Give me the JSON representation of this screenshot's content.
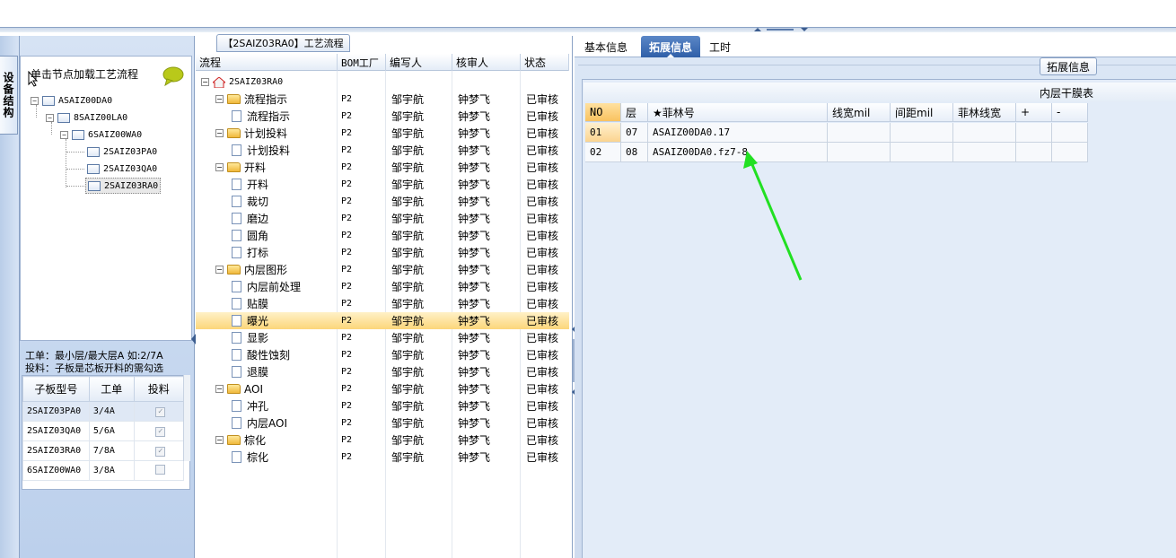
{
  "left": {
    "vertical_tab": "设备结构",
    "load_hint": "单击节点加载工艺流程",
    "tree": [
      {
        "label": "ASAIZ00DA0",
        "level": 0
      },
      {
        "label": "8SAIZ00LA0",
        "level": 1
      },
      {
        "label": "6SAIZ00WA0",
        "level": 2
      },
      {
        "label": "2SAIZ03PA0",
        "level": 3
      },
      {
        "label": "2SAIZ03QA0",
        "level": 3
      },
      {
        "label": "2SAIZ03RA0",
        "level": 3,
        "selected": true
      }
    ],
    "info_line1": "工单：最小层/最大层A 如:2/7A",
    "info_line2": "投料：子板是芯板开料的需勾选",
    "sub_table": {
      "headers": [
        "子板型号",
        "工单",
        "投料"
      ],
      "rows": [
        {
          "model": "2SAIZ03PA0",
          "order": "3/4A",
          "checked": true
        },
        {
          "model": "2SAIZ03QA0",
          "order": "5/6A",
          "checked": true
        },
        {
          "model": "2SAIZ03RA0",
          "order": "7/8A",
          "checked": true
        },
        {
          "model": "6SAIZ00WA0",
          "order": "3/8A",
          "checked": false
        }
      ]
    }
  },
  "middle": {
    "title": "【2SAIZ03RA0】工艺流程",
    "headers": [
      "流程",
      "BOM工厂",
      "编写人",
      "核审人",
      "状态"
    ],
    "root": "2SAIZ03RA0",
    "rows": [
      {
        "name": "流程指示",
        "type": "folder",
        "factory": "P2",
        "writer": "邹宇航",
        "reviewer": "钟梦飞",
        "status": "已审核"
      },
      {
        "name": "流程指示",
        "type": "leaf",
        "factory": "P2",
        "writer": "邹宇航",
        "reviewer": "钟梦飞",
        "status": "已审核"
      },
      {
        "name": "计划投料",
        "type": "folder",
        "factory": "P2",
        "writer": "邹宇航",
        "reviewer": "钟梦飞",
        "status": "已审核"
      },
      {
        "name": "计划投料",
        "type": "leaf",
        "factory": "P2",
        "writer": "邹宇航",
        "reviewer": "钟梦飞",
        "status": "已审核"
      },
      {
        "name": "开料",
        "type": "folder",
        "factory": "P2",
        "writer": "邹宇航",
        "reviewer": "钟梦飞",
        "status": "已审核"
      },
      {
        "name": "开料",
        "type": "leaf",
        "factory": "P2",
        "writer": "邹宇航",
        "reviewer": "钟梦飞",
        "status": "已审核"
      },
      {
        "name": "裁切",
        "type": "leaf",
        "factory": "P2",
        "writer": "邹宇航",
        "reviewer": "钟梦飞",
        "status": "已审核"
      },
      {
        "name": "磨边",
        "type": "leaf",
        "factory": "P2",
        "writer": "邹宇航",
        "reviewer": "钟梦飞",
        "status": "已审核"
      },
      {
        "name": "圆角",
        "type": "leaf",
        "factory": "P2",
        "writer": "邹宇航",
        "reviewer": "钟梦飞",
        "status": "已审核"
      },
      {
        "name": "打标",
        "type": "leaf",
        "factory": "P2",
        "writer": "邹宇航",
        "reviewer": "钟梦飞",
        "status": "已审核"
      },
      {
        "name": "内层图形",
        "type": "folder",
        "factory": "P2",
        "writer": "邹宇航",
        "reviewer": "钟梦飞",
        "status": "已审核"
      },
      {
        "name": "内层前处理",
        "type": "leaf",
        "factory": "P2",
        "writer": "邹宇航",
        "reviewer": "钟梦飞",
        "status": "已审核"
      },
      {
        "name": "贴膜",
        "type": "leaf",
        "factory": "P2",
        "writer": "邹宇航",
        "reviewer": "钟梦飞",
        "status": "已审核"
      },
      {
        "name": "曝光",
        "type": "leaf",
        "factory": "P2",
        "writer": "邹宇航",
        "reviewer": "钟梦飞",
        "status": "已审核",
        "selected": true
      },
      {
        "name": "显影",
        "type": "leaf",
        "factory": "P2",
        "writer": "邹宇航",
        "reviewer": "钟梦飞",
        "status": "已审核"
      },
      {
        "name": "酸性蚀刻",
        "type": "leaf",
        "factory": "P2",
        "writer": "邹宇航",
        "reviewer": "钟梦飞",
        "status": "已审核"
      },
      {
        "name": "退膜",
        "type": "leaf",
        "factory": "P2",
        "writer": "邹宇航",
        "reviewer": "钟梦飞",
        "status": "已审核"
      },
      {
        "name": "AOI",
        "type": "folder",
        "factory": "P2",
        "writer": "邹宇航",
        "reviewer": "钟梦飞",
        "status": "已审核"
      },
      {
        "name": "冲孔",
        "type": "leaf",
        "factory": "P2",
        "writer": "邹宇航",
        "reviewer": "钟梦飞",
        "status": "已审核"
      },
      {
        "name": "内层AOI",
        "type": "leaf",
        "factory": "P2",
        "writer": "邹宇航",
        "reviewer": "钟梦飞",
        "status": "已审核"
      },
      {
        "name": "棕化",
        "type": "folder",
        "factory": "P2",
        "writer": "邹宇航",
        "reviewer": "钟梦飞",
        "status": "已审核"
      },
      {
        "name": "棕化",
        "type": "leaf",
        "factory": "P2",
        "writer": "邹宇航",
        "reviewer": "钟梦飞",
        "status": "已审核"
      }
    ]
  },
  "right": {
    "tabs": [
      "基本信息",
      "拓展信息",
      "工时"
    ],
    "active_tab": "拓展信息",
    "section_label": "拓展信息",
    "grid_title": "内层干膜表",
    "headers": [
      "NO",
      "层",
      "★菲林号",
      "线宽mil",
      "间距mil",
      "菲林线宽",
      "+",
      "-"
    ],
    "rows": [
      {
        "no": "01",
        "layer": "07",
        "film": "ASAIZ00DA0.17"
      },
      {
        "no": "02",
        "layer": "08",
        "film": "ASAIZ00DA0.fz7-8"
      }
    ],
    "annotation_arrow_color": "#22e022"
  }
}
